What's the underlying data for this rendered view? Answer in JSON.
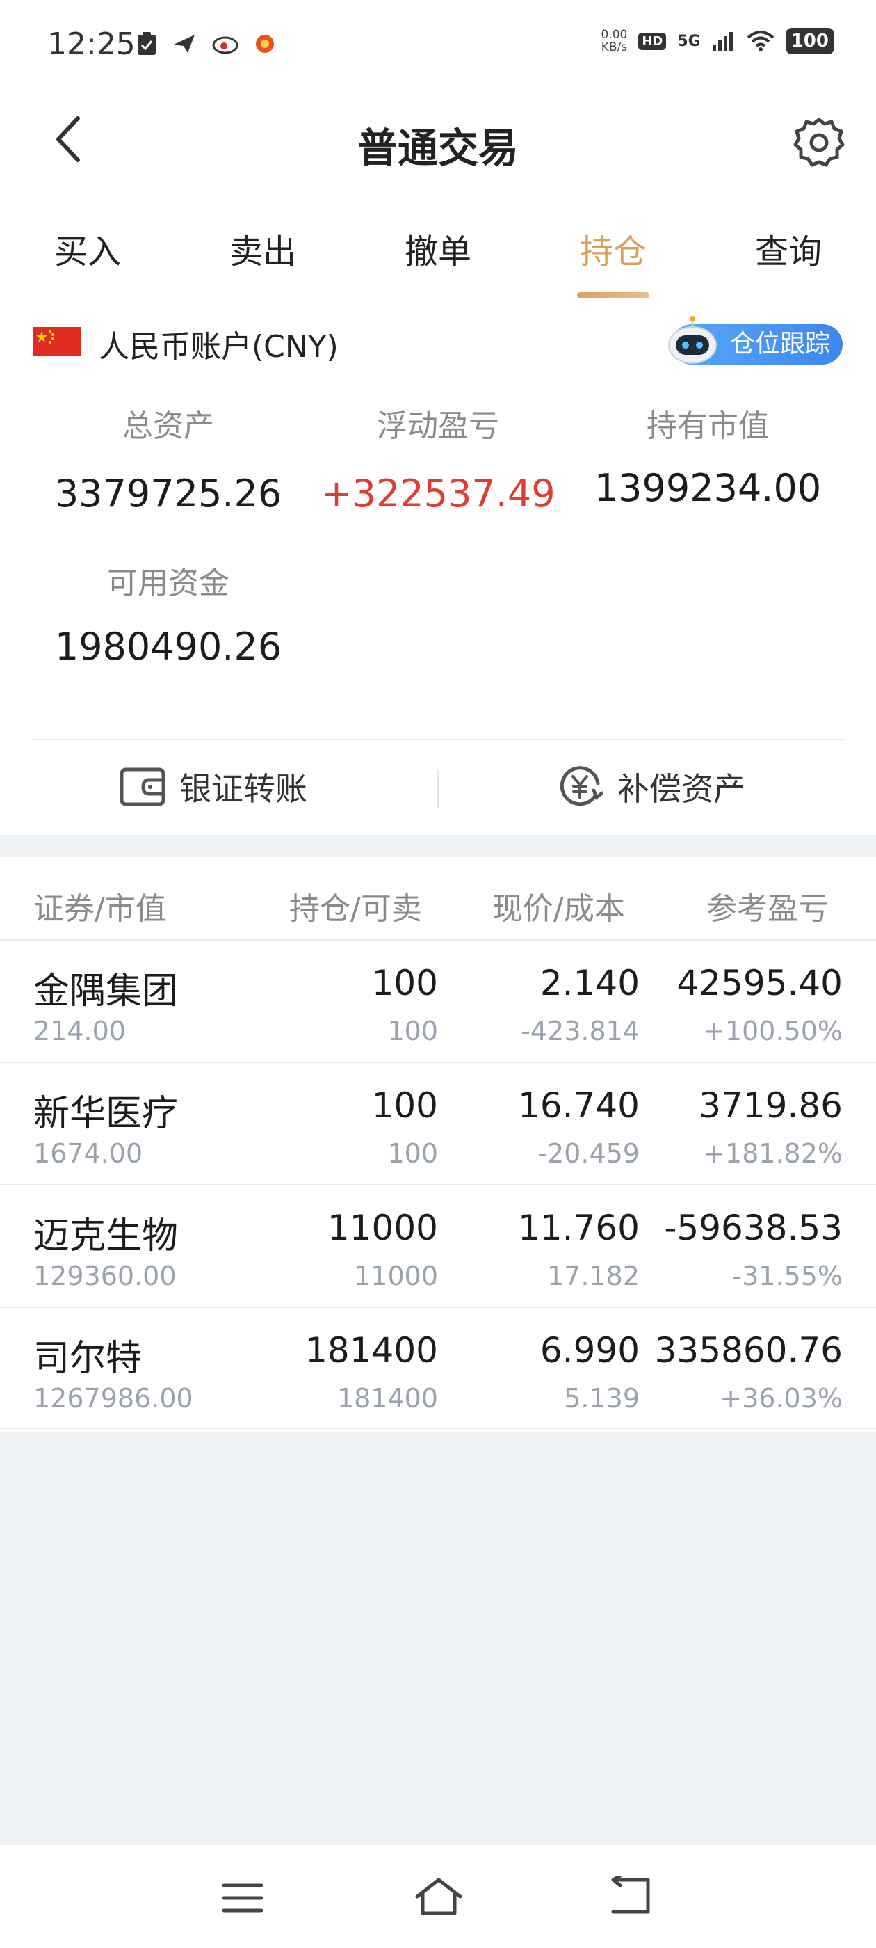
{
  "status_bar": {
    "time": "12:25",
    "net_speed_value": "0.00",
    "net_speed_unit": "KB/s",
    "hd": "HD",
    "network": "5G",
    "battery": "100"
  },
  "header": {
    "title": "普通交易"
  },
  "tabs": [
    {
      "label": "买入",
      "active": false
    },
    {
      "label": "卖出",
      "active": false
    },
    {
      "label": "撤单",
      "active": false
    },
    {
      "label": "持仓",
      "active": true
    },
    {
      "label": "查询",
      "active": false
    }
  ],
  "account": {
    "name": "人民币账户(CNY)",
    "track_button": "仓位跟踪",
    "metrics": {
      "total_assets_label": "总资产",
      "total_assets": "3379725.26",
      "floating_pl_label": "浮动盈亏",
      "floating_pl": "+322537.49",
      "market_value_label": "持有市值",
      "market_value": "1399234.00",
      "available_label": "可用资金",
      "available": "1980490.26"
    },
    "actions": {
      "transfer": "银证转账",
      "compensation": "补偿资产"
    }
  },
  "holdings": {
    "headers": [
      "证券/市值",
      "持仓/可卖",
      "现价/成本",
      "参考盈亏"
    ],
    "rows": [
      {
        "name": "金隅集团",
        "market_value": "214.00",
        "position": "100",
        "sellable": "100",
        "price": "2.140",
        "cost": "-423.814",
        "pl": "42595.40",
        "pl_pct": "+100.50%",
        "trend": "up"
      },
      {
        "name": "新华医疗",
        "market_value": "1674.00",
        "position": "100",
        "sellable": "100",
        "price": "16.740",
        "cost": "-20.459",
        "pl": "3719.86",
        "pl_pct": "+181.82%",
        "trend": "up"
      },
      {
        "name": "迈克生物",
        "market_value": "129360.00",
        "position": "11000",
        "sellable": "11000",
        "price": "11.760",
        "cost": "17.182",
        "pl": "-59638.53",
        "pl_pct": "-31.55%",
        "trend": "down"
      },
      {
        "name": "司尔特",
        "market_value": "1267986.00",
        "position": "181400",
        "sellable": "181400",
        "price": "6.990",
        "cost": "5.139",
        "pl": "335860.76",
        "pl_pct": "+36.03%",
        "trend": "up"
      }
    ]
  },
  "colors": {
    "accent": "#d9a158",
    "up": "#e03c31",
    "down": "#1fad6a",
    "track_blue": "#3d86ee"
  }
}
